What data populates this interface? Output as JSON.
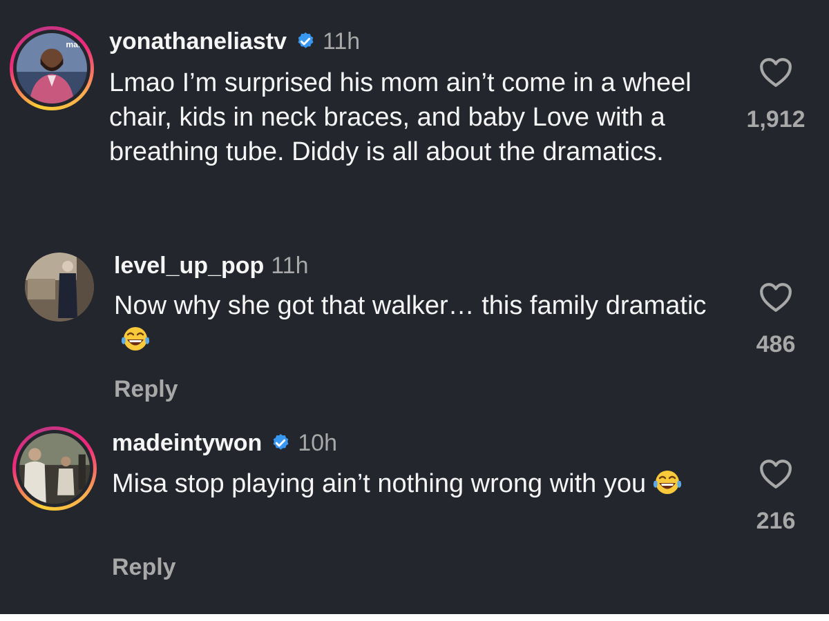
{
  "comments": [
    {
      "username": "yonathaneliastv",
      "verified": true,
      "time": "11h",
      "text": "Lmao I’m surprised his mom ain’t come in a wheel chair, kids in neck braces, and baby Love with a breathing tube. Diddy is all about the dramatics.",
      "likes": "1,912",
      "avatar_badge_text": "marl"
    },
    {
      "username": "level_up_pop",
      "verified": false,
      "time": "11h",
      "text": "Now why she got that walker… this family dramatic",
      "emoji": "😂",
      "likes": "486",
      "reply_label": "Reply"
    },
    {
      "username": "madeintywon",
      "verified": true,
      "time": "10h",
      "text": "Misa stop playing ain’t nothing wrong with you",
      "emoji": "😂",
      "likes": "216",
      "reply_label": "Reply"
    }
  ],
  "icons": {
    "like": "heart-outline-icon",
    "verified": "verified-badge-icon"
  },
  "colors": {
    "background": "#23262d",
    "text": "#f5f5f5",
    "secondary_text": "#a8a8a8",
    "verified_blue": "#3897f0"
  }
}
